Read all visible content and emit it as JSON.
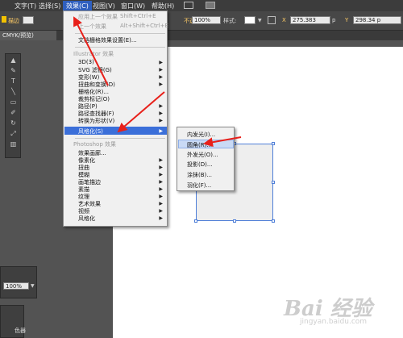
{
  "menubar": {
    "items": [
      "文字(T)",
      "选择(S)",
      "效果(C)",
      "视图(V)",
      "窗口(W)",
      "帮助(H)"
    ],
    "active": "效果(C)"
  },
  "controlbar": {
    "left_label": "描边",
    "opacity_label": "不透明度",
    "opacity_value": "100%",
    "style_label": "样式:",
    "x_value": "275.383",
    "x_unit": "p",
    "y_value": "298.34 p"
  },
  "tab": {
    "label": "CMYK/预览)"
  },
  "effect_menu": {
    "apply_last": {
      "label": "应用上一个效果",
      "shortcut": "Shift+Ctrl+E"
    },
    "last_effect": {
      "label": "上一个效果",
      "shortcut": "Alt+Shift+Ctrl+E"
    },
    "document_raster": "文档栅格效果设置(E)...",
    "illustrator_header": "Illustrator 效果",
    "illustrator_items": [
      "3D(3)",
      "SVG 滤镜(G)",
      "变形(W)",
      "扭曲和变换(D)",
      "栅格化(R)...",
      "裁剪标记(O)",
      "路径(P)",
      "路径查找器(F)",
      "转换为形状(V)",
      "风格化(S)"
    ],
    "photoshop_header": "Photoshop 效果",
    "photoshop_items": [
      "效果画廊...",
      "像素化",
      "扭曲",
      "模糊",
      "画笔描边",
      "素描",
      "纹理",
      "艺术效果",
      "视频",
      "风格化"
    ]
  },
  "stylize_submenu": {
    "items": [
      "内发光(I)...",
      "圆角(R)...",
      "外发光(O)...",
      "投影(D)...",
      "涂抹(B)...",
      "羽化(F)..."
    ],
    "highlighted": "圆角(R)..."
  },
  "panels": {
    "zoom_value": "100%",
    "bottom_label": "色器"
  },
  "watermark": {
    "logo": "Bai 经验",
    "url": "jingyan.baidu.com"
  },
  "colors": {
    "menu_highlight": "#3b6fd9",
    "annotation_arrow": "#e8201a",
    "selection_blue": "#4f7fd8"
  }
}
